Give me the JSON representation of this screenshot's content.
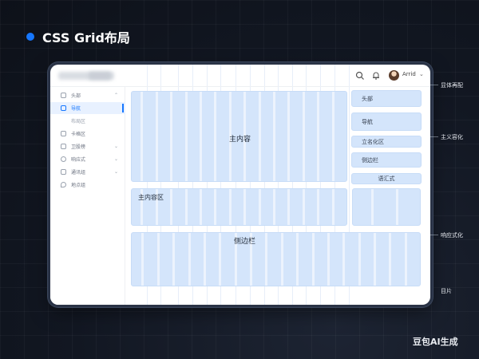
{
  "page": {
    "title": "CSS Grid布局"
  },
  "window": {
    "user": {
      "name": "Arrid"
    }
  },
  "sidebar": {
    "items": [
      {
        "label": "头部",
        "state": "expanded",
        "icon": "home-icon"
      },
      {
        "label": "导航",
        "state": "active",
        "icon": "nav-icon"
      },
      {
        "label": "布局区",
        "state": "sub"
      },
      {
        "label": "卡格区",
        "state": "sub",
        "icon": "grid-icon"
      },
      {
        "label": "卫股榜",
        "state": "collapsed",
        "icon": "table-icon"
      },
      {
        "label": "响应式",
        "state": "collapsed",
        "icon": "clock-icon"
      },
      {
        "label": "通讯组",
        "state": "collapsed",
        "icon": "chat-icon"
      },
      {
        "label": "地点组",
        "state": "collapsed",
        "icon": "pin-icon"
      }
    ]
  },
  "grid": {
    "main_content": "主内容",
    "main_area": "主内容区",
    "side_bar": "侧边栏",
    "right_items": [
      "头部",
      "导航",
      "立名化区",
      "侧边栏",
      "语汇式"
    ]
  },
  "annotations": [
    "显体再配",
    "主义容化",
    "响应式化",
    "目片"
  ],
  "brand": "豆包AI生成",
  "colors": {
    "accent": "#1677ff",
    "cell": "#d4e5fb",
    "background": "#121722"
  }
}
